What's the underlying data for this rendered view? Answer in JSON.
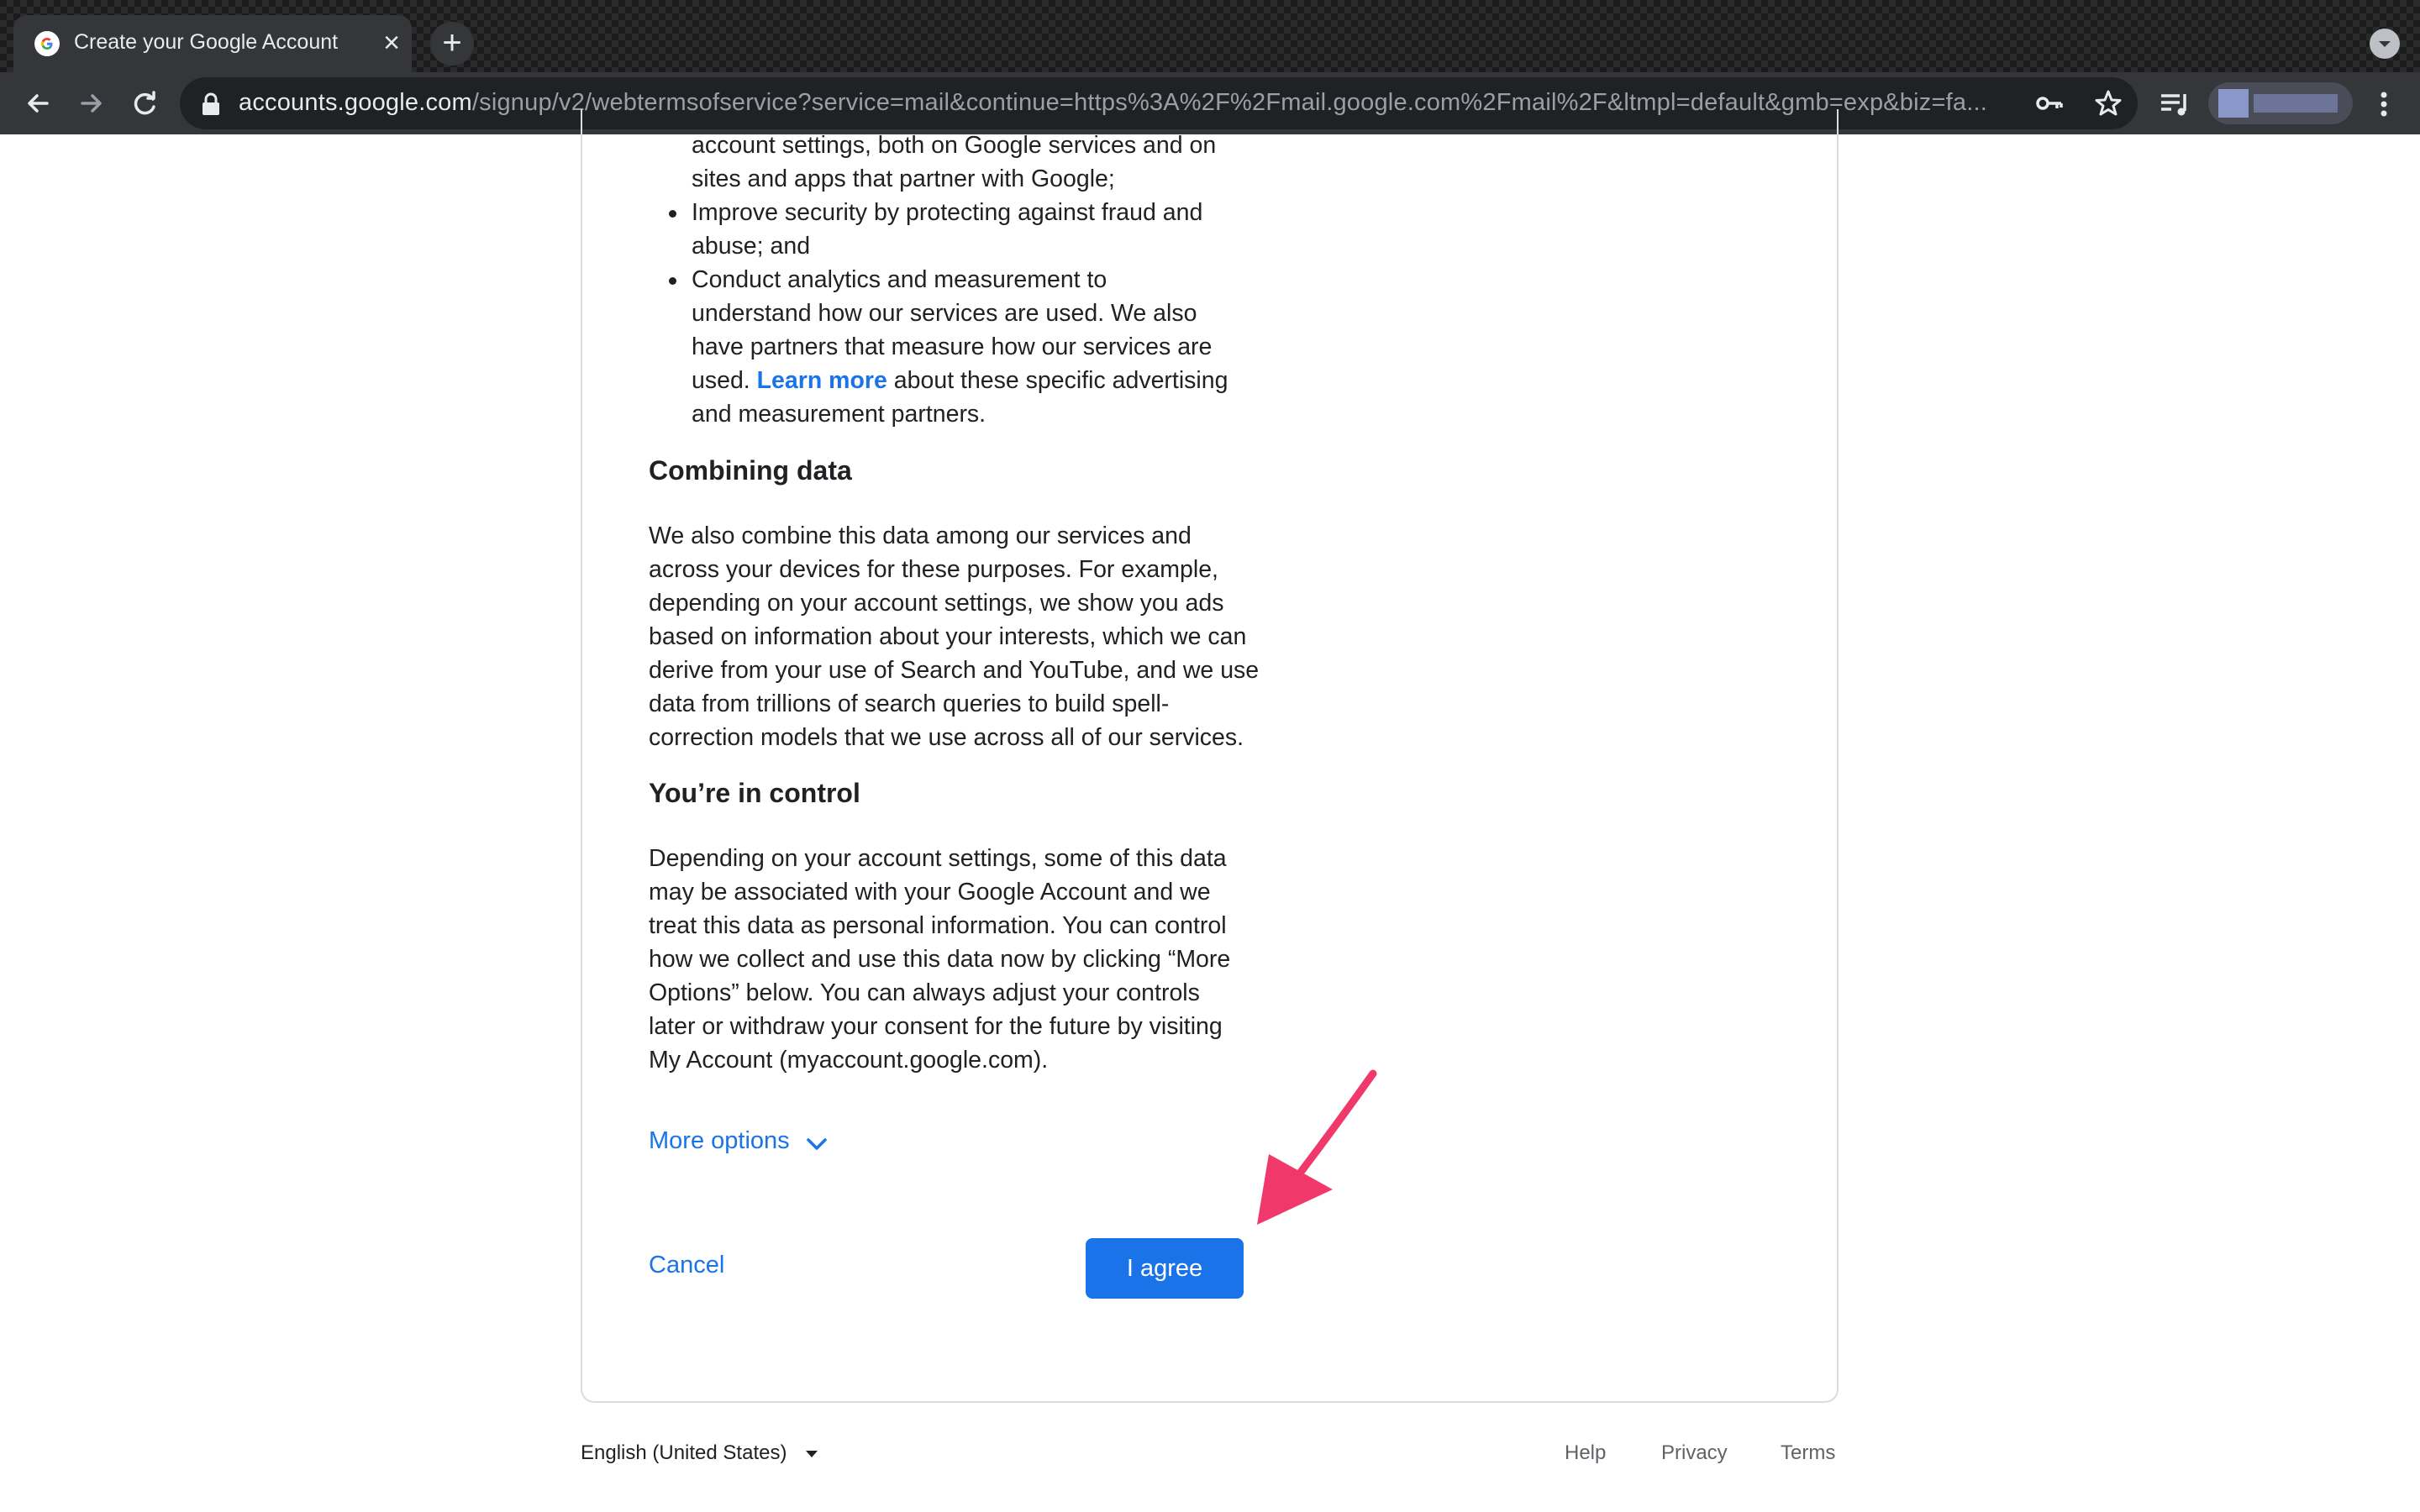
{
  "browser": {
    "tab_title": "Create your Google Account",
    "url_host": "accounts.google.com",
    "url_path": "/signup/v2/webtermsofservice?service=mail&continue=https%3A%2F%2Fmail.google.com%2Fmail%2F&ltmpl=default&gmb=exp&biz=fa..."
  },
  "bullets": [
    {
      "lines": [
        "account settings, both on Google services and on",
        "sites and apps that partner with Google;"
      ],
      "continued": true
    },
    {
      "lines": [
        "Improve security by protecting against fraud and",
        "abuse; and"
      ]
    },
    {
      "lines": [
        "Conduct analytics and measurement to",
        "understand how our services are used. We also",
        "have partners that measure how our services are"
      ],
      "l4_before": "used. ",
      "l4_link": "Learn more",
      "l4_after": " about these specific advertising",
      "l5": "and measurement partners."
    }
  ],
  "sections": {
    "combining": {
      "heading": "Combining data",
      "lines": [
        "We also combine this data among our services and",
        "across your devices for these purposes. For example,",
        "depending on your account settings, we show you ads",
        "based on information about your interests, which we can",
        "derive from your use of Search and YouTube, and we use",
        "data from trillions of search queries to build spell-",
        "correction models that we use across all of our services."
      ]
    },
    "control": {
      "heading": "You’re in control",
      "lines": [
        "Depending on your account settings, some of this data",
        "may be associated with your Google Account and we",
        "treat this data as personal information. You can control",
        "how we collect and use this data now by clicking “More",
        "Options” below. You can always adjust your controls",
        "later or withdraw your consent for the future by visiting",
        "My Account (myaccount.google.com)."
      ]
    }
  },
  "actions": {
    "more_options": "More options",
    "cancel": "Cancel",
    "agree": "I agree"
  },
  "footer": {
    "language": "English (United States)",
    "help": "Help",
    "privacy": "Privacy",
    "terms": "Terms"
  },
  "colors": {
    "accent": "#1a73e8",
    "annotation_arrow": "#f0386b"
  }
}
